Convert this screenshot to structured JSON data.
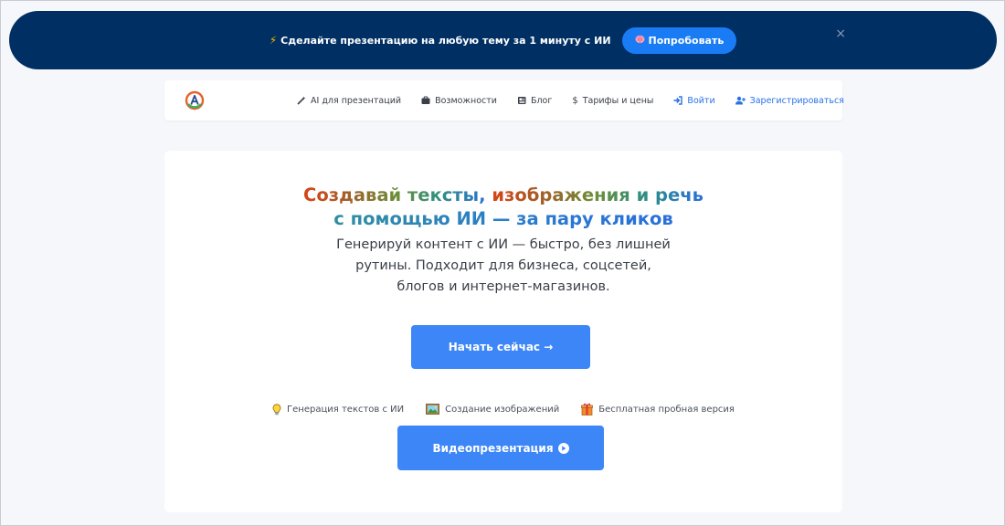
{
  "banner": {
    "text": "Сделайте презентацию на любую тему за 1 минуту с ИИ",
    "try_label": "Попробовать",
    "close_glyph": "×"
  },
  "nav": {
    "items": [
      {
        "label": "AI для презентаций",
        "icon": "magic-wand-icon"
      },
      {
        "label": "Возможности",
        "icon": "briefcase-icon"
      },
      {
        "label": "Блог",
        "icon": "newspaper-icon"
      },
      {
        "label": "Тарифы и цены",
        "icon": "dollar-icon"
      },
      {
        "label": "Войти",
        "icon": "sign-in-icon"
      },
      {
        "label": "Зарегистрироваться",
        "icon": "user-plus-icon"
      }
    ]
  },
  "hero": {
    "headline_line1_a": "Создавай тексты, ",
    "headline_line1_b": "изображения и речь",
    "headline_line2": "с помощью ИИ — за пару кликов",
    "subtitle_line1": "Генерируй контент с ИИ — быстро, без лишней",
    "subtitle_line2": "рутины. Подходит для бизнеса, соцсетей,",
    "subtitle_line3": "блогов и интернет-магазинов.",
    "start_label": "Начать сейчас →",
    "video_label": "Видеопрезентация"
  },
  "features": [
    {
      "label": "Генерация текстов с ИИ",
      "icon": "lightbulb-icon"
    },
    {
      "label": "Создание изображений",
      "icon": "picture-icon"
    },
    {
      "label": "Бесплатная пробная версия",
      "icon": "gift-icon"
    }
  ],
  "colors": {
    "banner_bg": "#002f63",
    "accent": "#1a7cf5",
    "button": "#3d86f7",
    "link": "#2a72e6"
  }
}
